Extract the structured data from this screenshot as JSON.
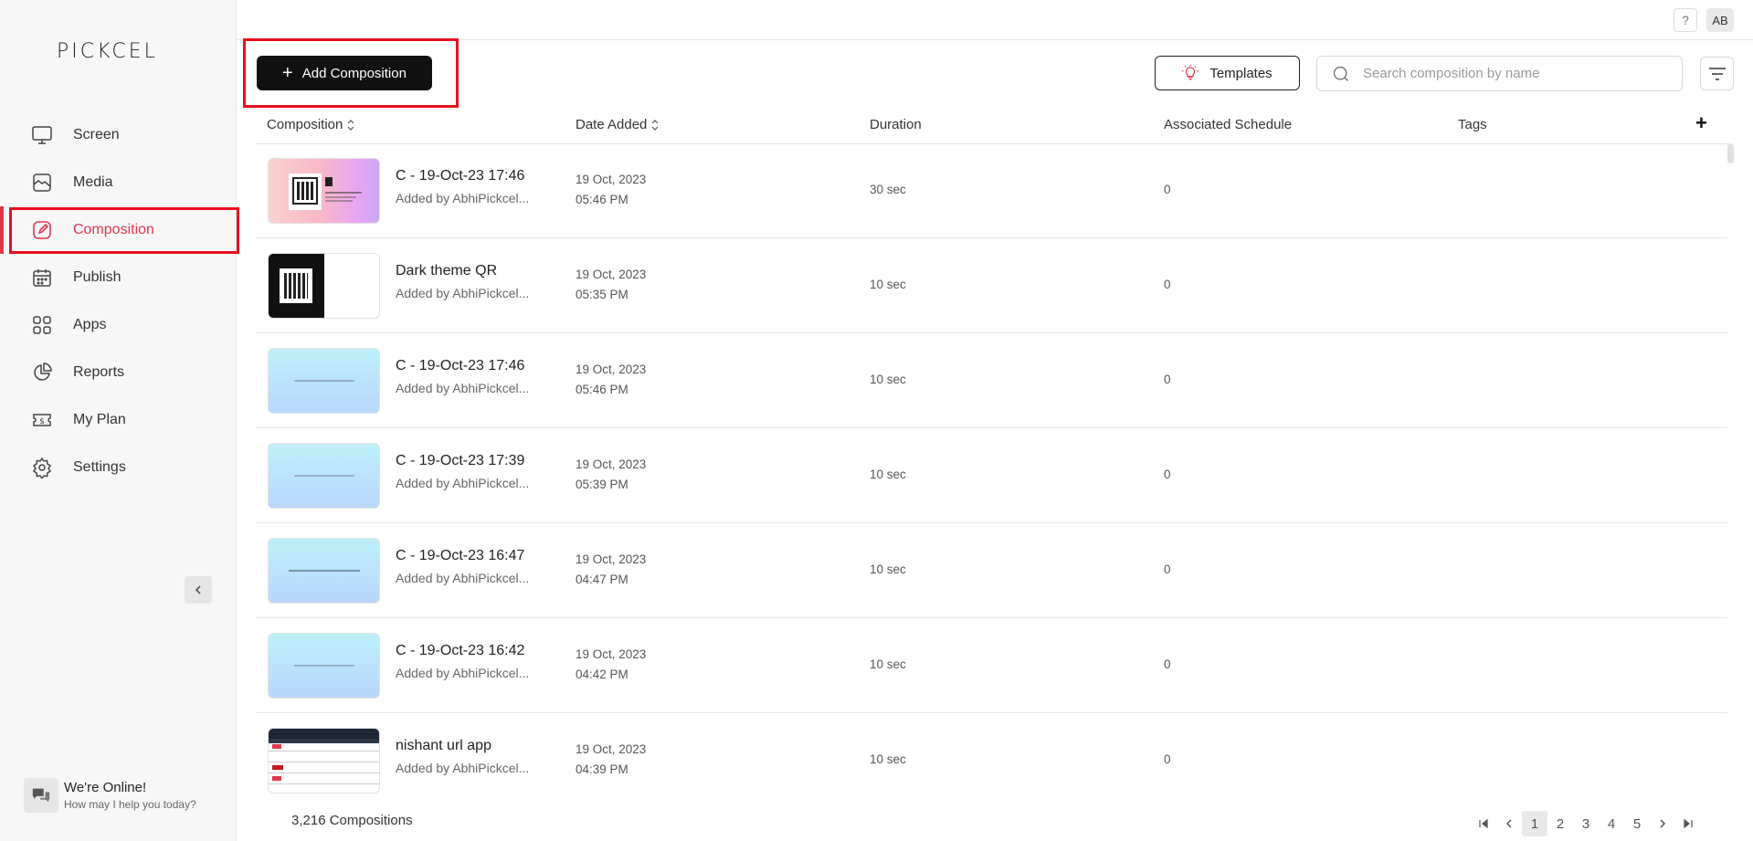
{
  "app": {
    "logo": "PICKCEL"
  },
  "sidebar": {
    "items": [
      {
        "key": "screen",
        "label": "Screen"
      },
      {
        "key": "media",
        "label": "Media"
      },
      {
        "key": "composition",
        "label": "Composition",
        "active": true
      },
      {
        "key": "publish",
        "label": "Publish"
      },
      {
        "key": "apps",
        "label": "Apps"
      },
      {
        "key": "reports",
        "label": "Reports"
      },
      {
        "key": "myplan",
        "label": "My Plan"
      },
      {
        "key": "settings",
        "label": "Settings"
      }
    ],
    "chat": {
      "title": "We're Online!",
      "subtitle": "How may I help you today?"
    }
  },
  "topbar": {
    "help": "?",
    "avatar": "AB"
  },
  "toolbar": {
    "add_label": "Add Composition",
    "templates_label": "Templates",
    "search_placeholder": "Search composition by name"
  },
  "table": {
    "columns": [
      "Composition",
      "Date Added",
      "Duration",
      "Associated Schedule",
      "Tags"
    ],
    "rows": [
      {
        "name": "C - 19-Oct-23 17:46",
        "added_by": "Added by AbhiPickcel...",
        "date": "19 Oct, 2023",
        "time": "05:46 PM",
        "duration": "30 sec",
        "schedules": "0",
        "thumb": "pink"
      },
      {
        "name": "Dark theme QR",
        "added_by": "Added by AbhiPickcel...",
        "date": "19 Oct, 2023",
        "time": "05:35 PM",
        "duration": "10 sec",
        "schedules": "0",
        "thumb": "dark"
      },
      {
        "name": "C - 19-Oct-23 17:46",
        "added_by": "Added by AbhiPickcel...",
        "date": "19 Oct, 2023",
        "time": "05:46 PM",
        "duration": "10 sec",
        "schedules": "0",
        "thumb": "blue"
      },
      {
        "name": "C - 19-Oct-23 17:39",
        "added_by": "Added by AbhiPickcel...",
        "date": "19 Oct, 2023",
        "time": "05:39 PM",
        "duration": "10 sec",
        "schedules": "0",
        "thumb": "blue"
      },
      {
        "name": "C - 19-Oct-23 16:47",
        "added_by": "Added by AbhiPickcel...",
        "date": "19 Oct, 2023",
        "time": "04:47 PM",
        "duration": "10 sec",
        "schedules": "0",
        "thumb": "blue"
      },
      {
        "name": "C - 19-Oct-23 16:42",
        "added_by": "Added by AbhiPickcel...",
        "date": "19 Oct, 2023",
        "time": "04:42 PM",
        "duration": "10 sec",
        "schedules": "0",
        "thumb": "blue"
      },
      {
        "name": "nishant url app",
        "added_by": "Added by AbhiPickcel...",
        "date": "19 Oct, 2023",
        "time": "04:39 PM",
        "duration": "10 sec",
        "schedules": "0",
        "thumb": "table"
      }
    ]
  },
  "footer": {
    "count": "3,216 Compositions",
    "pages": [
      "1",
      "2",
      "3",
      "4",
      "5"
    ],
    "current_page": "1"
  },
  "colors": {
    "accent": "#e0384b",
    "highlight": "#e8101f",
    "primary_button": "#111111"
  }
}
